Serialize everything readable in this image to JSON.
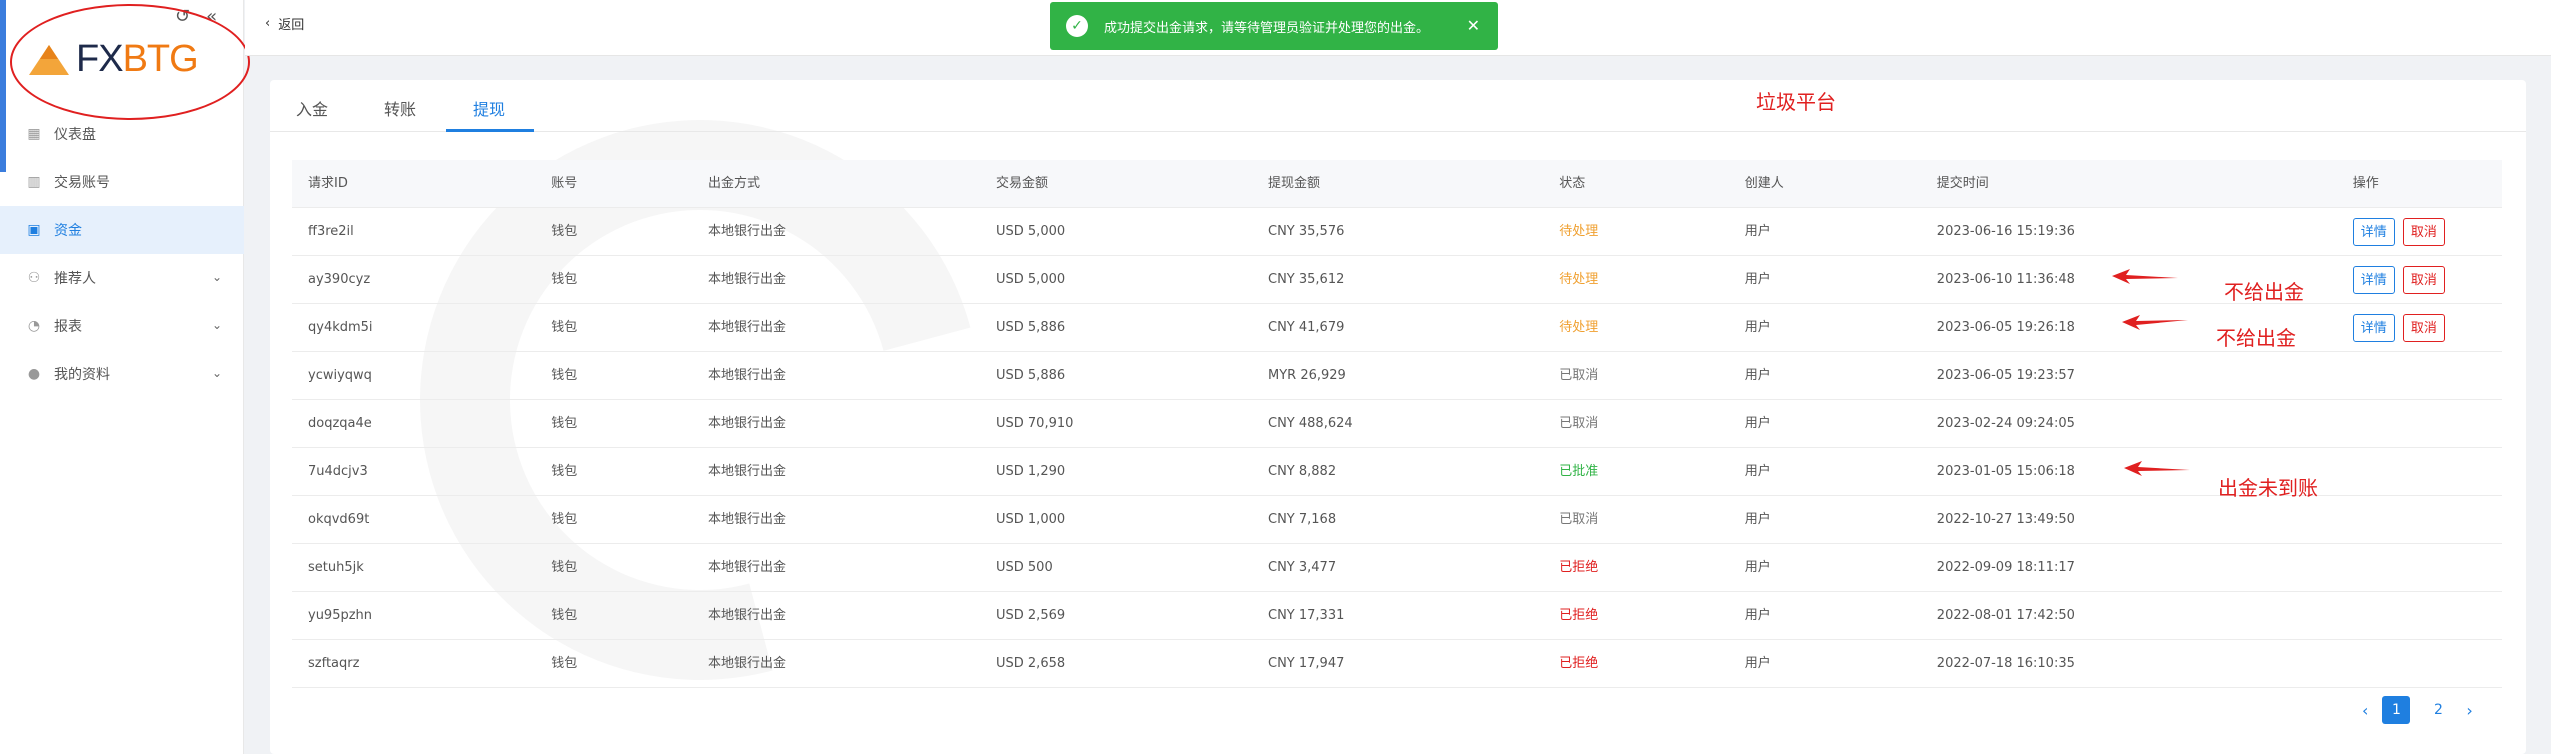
{
  "brand": {
    "fx": "FX",
    "btg": "BTG"
  },
  "sidebar": {
    "items": [
      {
        "label": "仪表盘",
        "icon": "dashboard-icon",
        "active": false,
        "expandable": false
      },
      {
        "label": "交易账号",
        "icon": "bars-icon",
        "active": false,
        "expandable": false
      },
      {
        "label": "资金",
        "icon": "wallet-icon",
        "active": true,
        "expandable": false
      },
      {
        "label": "推荐人",
        "icon": "users-icon",
        "active": false,
        "expandable": true
      },
      {
        "label": "报表",
        "icon": "pie-chart-icon",
        "active": false,
        "expandable": true
      },
      {
        "label": "我的资料",
        "icon": "user-icon",
        "active": false,
        "expandable": true
      }
    ]
  },
  "header": {
    "back_label": "返回"
  },
  "toast": {
    "message": "成功提交出金请求，请等待管理员验证并处理您的出金。"
  },
  "tabs": [
    {
      "label": "入金",
      "active": false
    },
    {
      "label": "转账",
      "active": false
    },
    {
      "label": "提现",
      "active": true
    }
  ],
  "annotations": {
    "platform_note": "垃圾平台",
    "note1": "不给出金",
    "note2": "不给出金",
    "note3": "出金未到账"
  },
  "table": {
    "columns": [
      "请求ID",
      "账号",
      "出金方式",
      "交易金额",
      "提现金额",
      "状态",
      "创建人",
      "提交时间",
      "操作"
    ],
    "action_labels": {
      "detail": "详情",
      "cancel": "取消"
    },
    "rows": [
      {
        "id": "ff3re2il",
        "account": "钱包",
        "method": "本地银行出金",
        "amount": "USD 5,000",
        "withdraw": "CNY 35,576",
        "status": "待处理",
        "status_type": "pending",
        "creator": "用户",
        "time": "2023-06-16 15:19:36",
        "actions": true
      },
      {
        "id": "ay390cyz",
        "account": "钱包",
        "method": "本地银行出金",
        "amount": "USD 5,000",
        "withdraw": "CNY 35,612",
        "status": "待处理",
        "status_type": "pending",
        "creator": "用户",
        "time": "2023-06-10 11:36:48",
        "actions": true
      },
      {
        "id": "qy4kdm5i",
        "account": "钱包",
        "method": "本地银行出金",
        "amount": "USD 5,886",
        "withdraw": "CNY 41,679",
        "status": "待处理",
        "status_type": "pending",
        "creator": "用户",
        "time": "2023-06-05 19:26:18",
        "actions": true
      },
      {
        "id": "ycwiyqwq",
        "account": "钱包",
        "method": "本地银行出金",
        "amount": "USD 5,886",
        "withdraw": "MYR 26,929",
        "status": "已取消",
        "status_type": "cancel",
        "creator": "用户",
        "time": "2023-06-05 19:23:57",
        "actions": false
      },
      {
        "id": "doqzqa4e",
        "account": "钱包",
        "method": "本地银行出金",
        "amount": "USD 70,910",
        "withdraw": "CNY 488,624",
        "status": "已取消",
        "status_type": "cancel",
        "creator": "用户",
        "time": "2023-02-24 09:24:05",
        "actions": false
      },
      {
        "id": "7u4dcjv3",
        "account": "钱包",
        "method": "本地银行出金",
        "amount": "USD 1,290",
        "withdraw": "CNY 8,882",
        "status": "已批准",
        "status_type": "approved",
        "creator": "用户",
        "time": "2023-01-05 15:06:18",
        "actions": false
      },
      {
        "id": "okqvd69t",
        "account": "钱包",
        "method": "本地银行出金",
        "amount": "USD 1,000",
        "withdraw": "CNY 7,168",
        "status": "已取消",
        "status_type": "cancel",
        "creator": "用户",
        "time": "2022-10-27 13:49:50",
        "actions": false
      },
      {
        "id": "setuh5jk",
        "account": "钱包",
        "method": "本地银行出金",
        "amount": "USD 500",
        "withdraw": "CNY 3,477",
        "status": "已拒绝",
        "status_type": "rejected",
        "creator": "用户",
        "time": "2022-09-09 18:11:17",
        "actions": false
      },
      {
        "id": "yu95pzhn",
        "account": "钱包",
        "method": "本地银行出金",
        "amount": "USD 2,569",
        "withdraw": "CNY 17,331",
        "status": "已拒绝",
        "status_type": "rejected",
        "creator": "用户",
        "time": "2022-08-01 17:42:50",
        "actions": false
      },
      {
        "id": "szftaqrz",
        "account": "钱包",
        "method": "本地银行出金",
        "amount": "USD 2,658",
        "withdraw": "CNY 17,947",
        "status": "已拒绝",
        "status_type": "rejected",
        "creator": "用户",
        "time": "2022-07-18 16:10:35",
        "actions": false
      }
    ]
  },
  "pagination": {
    "pages": [
      "1",
      "2"
    ],
    "current": "1"
  },
  "colors": {
    "primary": "#1f7fe0",
    "success": "#31b346",
    "danger": "#e02020",
    "warning": "#f0a030",
    "brand_orange": "#f07a13"
  }
}
